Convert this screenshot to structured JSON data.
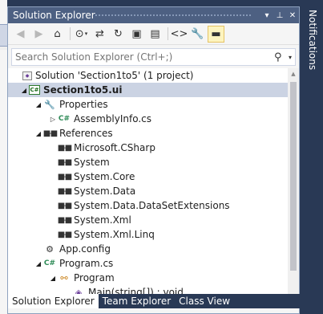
{
  "window": {
    "title": "Solution Explorer",
    "dropdown_glyph": "▾",
    "pin_glyph": "⊥",
    "close_glyph": "✕"
  },
  "toolbar": {
    "back": "◀",
    "forward": "▶",
    "home": "⌂",
    "history": "⊙",
    "history_caret": "▾",
    "sync": "⇄",
    "refresh": "↻",
    "collapse": "▣",
    "show_all": "▤",
    "view_code": "<>",
    "properties": "🔧",
    "preview": "▬"
  },
  "search": {
    "placeholder": "Search Solution Explorer (Ctrl+;)",
    "icon": "⚲",
    "caret": "▾"
  },
  "tree": {
    "solution": "Solution 'Section1to5' (1 project)",
    "project": "Section1to5.ui",
    "properties": "Properties",
    "assemblyinfo": "AssemblyInfo.cs",
    "references": "References",
    "refs": [
      "Microsoft.CSharp",
      "System",
      "System.Core",
      "System.Data",
      "System.Data.DataSetExtensions",
      "System.Xml",
      "System.Xml.Linq"
    ],
    "appconfig": "App.config",
    "programcs": "Program.cs",
    "program": "Program",
    "main": "Main(string[]) : void"
  },
  "tabs": [
    "Solution Explorer",
    "Team Explorer",
    "Class View"
  ],
  "side_panel": {
    "notifications": "Notifications"
  },
  "icons": {
    "expanded": "◢",
    "collapsed": "▷",
    "csharp_label": "C#"
  },
  "colors": {
    "title_bar": "#4d6082",
    "background": "#293955",
    "selected_row": "#cbd3e3"
  }
}
